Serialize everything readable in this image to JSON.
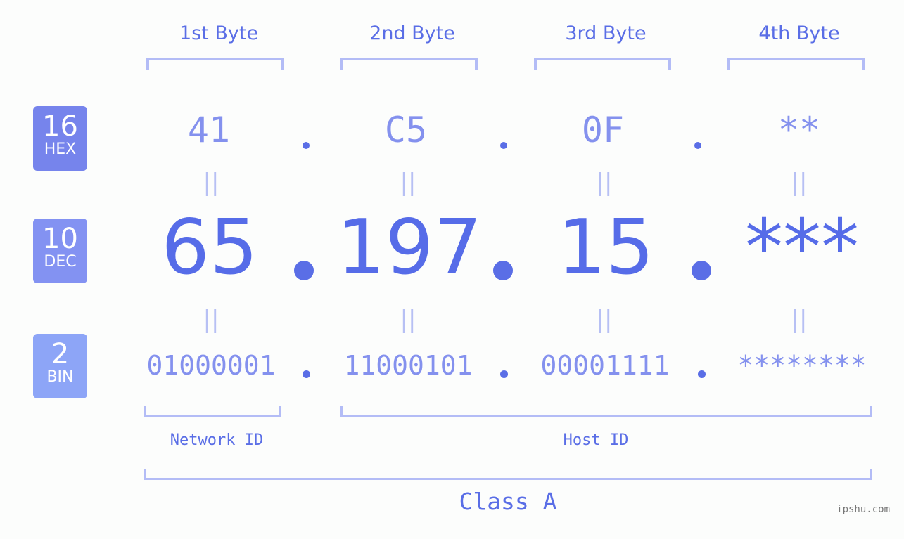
{
  "headers": [
    "1st Byte",
    "2nd Byte",
    "3rd Byte",
    "4th Byte"
  ],
  "badges": [
    {
      "num": "16",
      "label": "HEX",
      "color": "#7684ec"
    },
    {
      "num": "10",
      "label": "DEC",
      "color": "#8392f2"
    },
    {
      "num": "2",
      "label": "BIN",
      "color": "#8da5f7"
    }
  ],
  "hex": [
    "41",
    "C5",
    "0F",
    "**"
  ],
  "dec": [
    "65",
    "197",
    "15",
    "***"
  ],
  "bin": [
    "01000001",
    "11000101",
    "00001111",
    "********"
  ],
  "equals_glyph": "||",
  "network_label": "Network ID",
  "host_label": "Host ID",
  "class_label": "Class A",
  "footer": "ipshu.com"
}
